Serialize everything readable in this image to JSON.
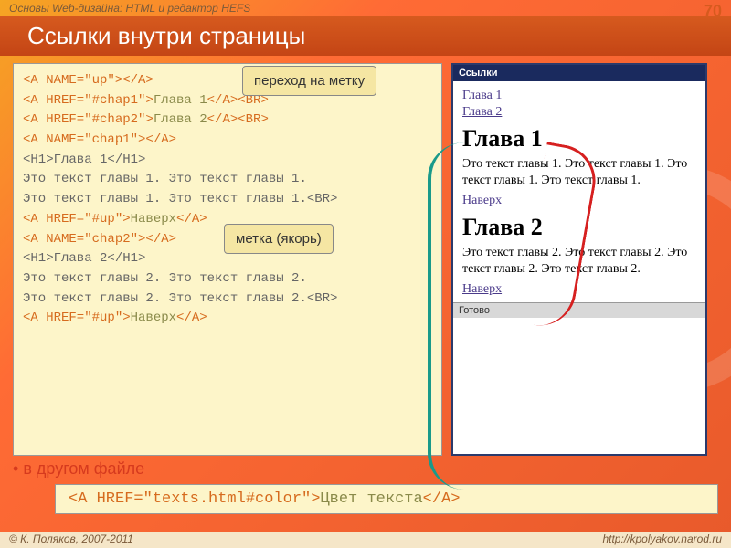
{
  "header": {
    "left": "Основы Web-дизайна: HTML и редактор HEFS",
    "page": "70"
  },
  "title": "Ссылки внутри страницы",
  "callouts": {
    "jump": "переход на метку",
    "anchor": "метка (якорь)"
  },
  "code": {
    "l1a": "<A NAME=\"up\">",
    "l1b": "</A>",
    "l2a": "<A HREF=\"#chap1\">",
    "l2b": "Глава 1",
    "l2c": "</A><BR>",
    "l3a": "<A HREF=\"#chap2\">",
    "l3b": "Глава 2",
    "l3c": "</A><BR>",
    "l4a": "<A NAME=\"chap1\">",
    "l4b": "</A>",
    "l5": "<H1>Глава 1</H1>",
    "l6": "Это текст главы 1. Это текст главы 1.",
    "l7": "Это текст главы 1. Это текст главы 1.<BR>",
    "l8a": "<A HREF=\"#up\">",
    "l8b": "Наверх",
    "l8c": "</A>",
    "l9a": "<A NAME=\"chap2\">",
    "l9b": "</A>",
    "l10": "<H1>Глава 2</H1>",
    "l11": "Это текст главы 2. Это текст главы 2.",
    "l12": "Это текст главы 2. Это текст главы 2.<BR>",
    "l13a": "<A HREF=\"#up\">",
    "l13b": "Наверх",
    "l13c": "</A>"
  },
  "preview": {
    "title": "Ссылки",
    "link1": "Глава 1",
    "link2": "Глава 2",
    "h1a": "Глава 1",
    "p1": "Это текст главы 1. Это текст главы 1. Это текст главы 1. Это текст главы 1.",
    "up1": "Наверх",
    "h1b": "Глава 2",
    "p2": "Это текст главы 2. Это текст главы 2. Это текст главы 2. Это текст главы 2.",
    "up2": "Наверх",
    "status": "Готово"
  },
  "bullet": "в другом файле",
  "bottom": {
    "a": "<A HREF=\"texts.html#color\">",
    "b": "Цвет текста",
    "c": "</A>"
  },
  "footer": {
    "left": "© К. Поляков, 2007-2011",
    "right": "http://kpolyakov.narod.ru"
  }
}
